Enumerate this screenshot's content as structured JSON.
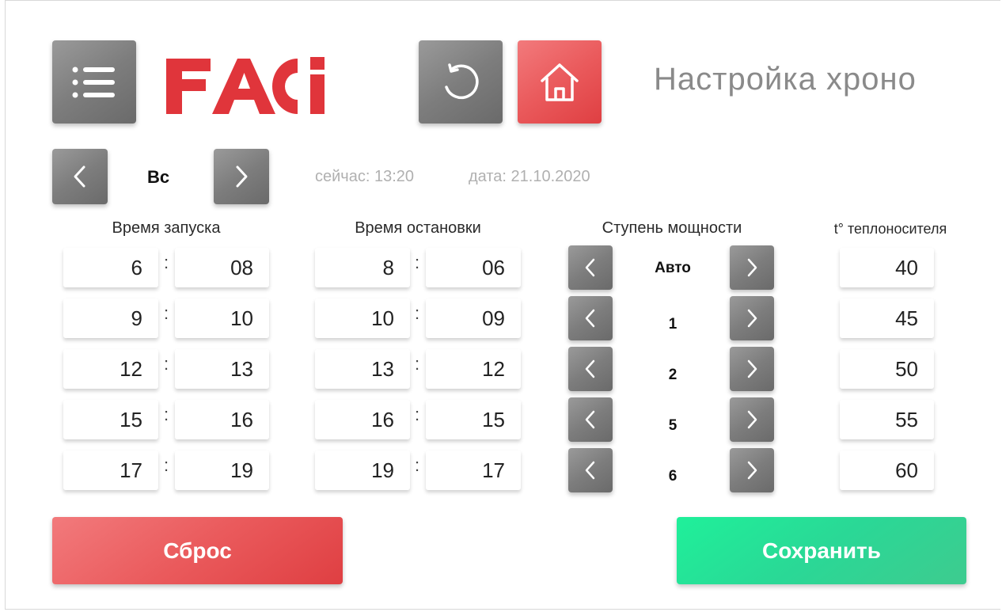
{
  "header": {
    "title": "Настройка хроно",
    "logo_text": "FACi",
    "menu_icon": "menu-icon",
    "undo_icon": "undo-icon",
    "home_icon": "home-icon"
  },
  "day_nav": {
    "day": "Вс",
    "prev_icon": "chevron-left-icon",
    "next_icon": "chevron-right-icon"
  },
  "info": {
    "now": "сейчас: 13:20",
    "date": "дата: 21.10.2020"
  },
  "columns": {
    "start": "Время запуска",
    "stop": "Время остановки",
    "power": "Ступень мощности",
    "temp": "t° теплоносителя"
  },
  "rows": [
    {
      "start_h": "6",
      "start_m": "08",
      "stop_h": "8",
      "stop_m": "06",
      "power": "Авто",
      "temp": "40"
    },
    {
      "start_h": "9",
      "start_m": "10",
      "stop_h": "10",
      "stop_m": "09",
      "power": "1",
      "temp": "45"
    },
    {
      "start_h": "12",
      "start_m": "13",
      "stop_h": "13",
      "stop_m": "12",
      "power": "2",
      "temp": "50"
    },
    {
      "start_h": "15",
      "start_m": "16",
      "stop_h": "16",
      "stop_m": "15",
      "power": "5",
      "temp": "55"
    },
    {
      "start_h": "17",
      "start_m": "19",
      "stop_h": "19",
      "stop_m": "17",
      "power": "6",
      "temp": "60"
    }
  ],
  "separator": ":",
  "actions": {
    "reset": "Сброс",
    "save": "Сохранить"
  },
  "colors": {
    "brand_red": "#e0353b",
    "accent_red": "#ea5a5c",
    "accent_green": "#2ad896",
    "button_gray": "#7d7d7d"
  }
}
